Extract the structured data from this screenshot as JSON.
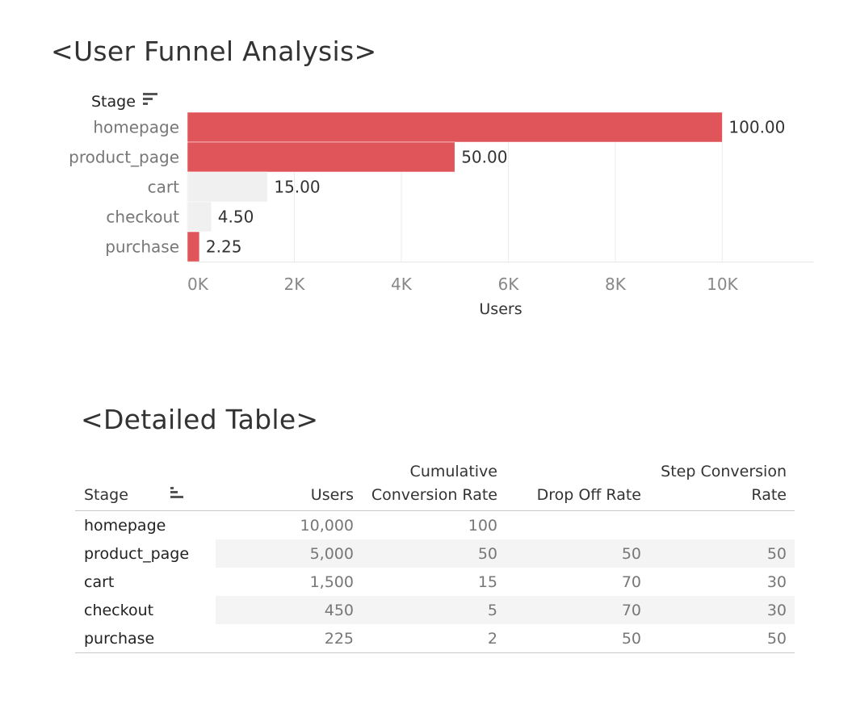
{
  "chart_title": "<User Funnel Analysis>",
  "table_title": "<Detailed Table>",
  "chart_data": {
    "type": "bar",
    "orientation": "horizontal",
    "categories": [
      "homepage",
      "product_page",
      "cart",
      "checkout",
      "purchase"
    ],
    "values": [
      10000,
      5000,
      1500,
      450,
      225
    ],
    "data_labels": [
      "100.00",
      "50.00",
      "15.00",
      "4.50",
      "2.25"
    ],
    "bar_colors": [
      "#e05559",
      "#e05559",
      "#f0f0f0",
      "#f0f0f0",
      "#e05559"
    ],
    "xlabel": "Users",
    "ylabel": "Stage",
    "xlim": [
      0,
      11700
    ],
    "x_ticks": [
      0,
      2000,
      4000,
      6000,
      8000,
      10000
    ],
    "x_tick_labels": [
      "0K",
      "2K",
      "4K",
      "6K",
      "8K",
      "10K"
    ],
    "grid": true
  },
  "table": {
    "headers": {
      "stage": "Stage",
      "users": "Users",
      "cum_line1": "Cumulative",
      "cum_line2": "Conversion Rate",
      "drop": "Drop Off Rate",
      "step_line1": "Step Conversion",
      "step_line2": "Rate"
    },
    "rows": [
      {
        "stage": "homepage",
        "users": "10,000",
        "cum": "100",
        "drop": "",
        "step": ""
      },
      {
        "stage": "product_page",
        "users": "5,000",
        "cum": "50",
        "drop": "50",
        "step": "50"
      },
      {
        "stage": "cart",
        "users": "1,500",
        "cum": "15",
        "drop": "70",
        "step": "30"
      },
      {
        "stage": "checkout",
        "users": "450",
        "cum": "5",
        "drop": "70",
        "step": "30"
      },
      {
        "stage": "purchase",
        "users": "225",
        "cum": "2",
        "drop": "50",
        "step": "50"
      }
    ]
  }
}
